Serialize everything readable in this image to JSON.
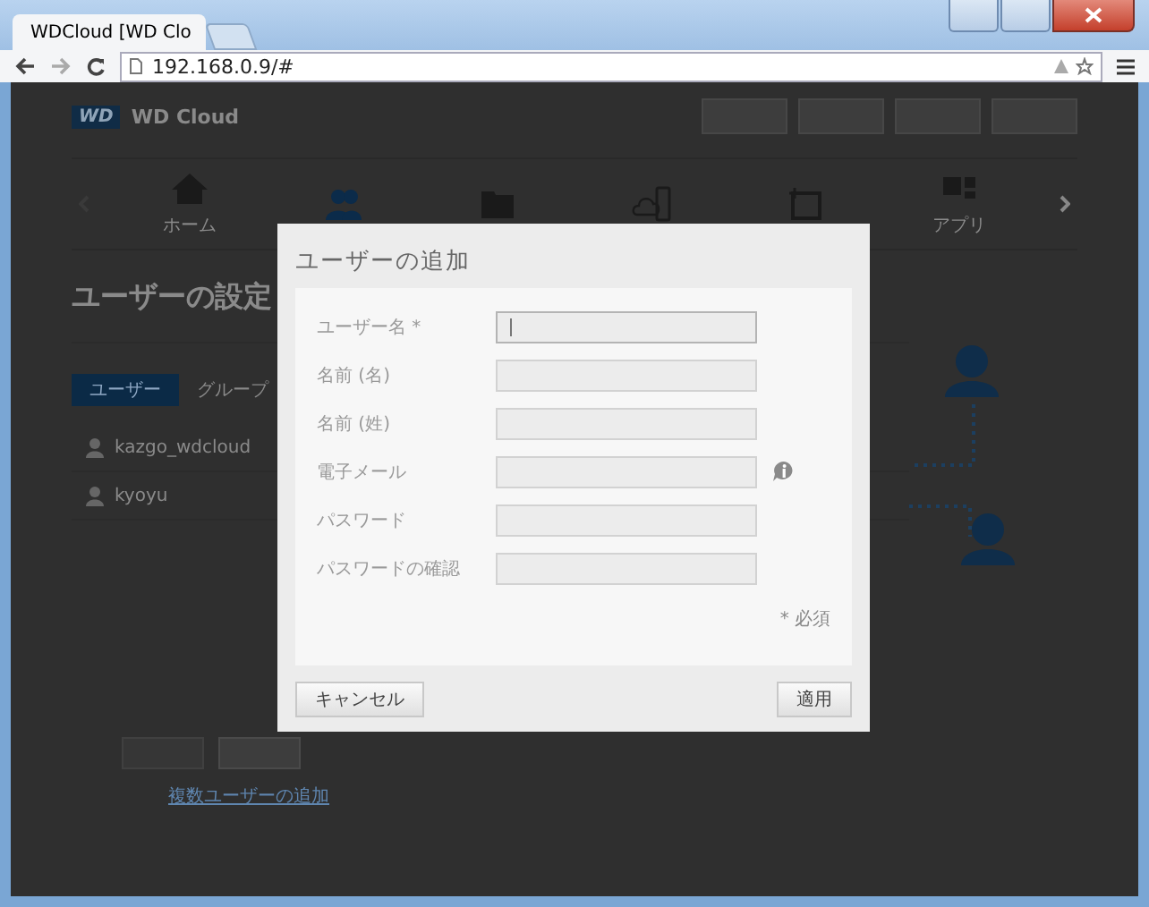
{
  "browser": {
    "tab_title": "WDCloud [WD Clo",
    "url": "192.168.0.9/#"
  },
  "app": {
    "logo": "WD",
    "name": "WD Cloud"
  },
  "nav": [
    {
      "kind": "home",
      "label": "ホーム",
      "selected": false
    },
    {
      "kind": "users",
      "selected": true
    },
    {
      "kind": "folder",
      "selected": false
    },
    {
      "kind": "cloud",
      "selected": false
    },
    {
      "kind": "backup",
      "selected": false
    },
    {
      "kind": "apps",
      "label": "アプリ",
      "selected": false
    }
  ],
  "page_title": "ユーザーの設定",
  "tabs": [
    {
      "label": "ユーザー",
      "selected": true
    },
    {
      "label": "グループ",
      "selected": false
    }
  ],
  "users": [
    {
      "name": "kazgo_wdcloud"
    },
    {
      "name": "kyoyu"
    }
  ],
  "add_multiple_link": "複数ユーザーの追加",
  "dialog": {
    "title": "ユーザーの追加",
    "fields": [
      {
        "label": "ユーザー名 *",
        "focused": true,
        "info": false
      },
      {
        "label": "名前 (名)",
        "focused": false,
        "info": false
      },
      {
        "label": "名前 (姓)",
        "focused": false,
        "info": false
      },
      {
        "label": "電子メール",
        "focused": false,
        "info": true
      },
      {
        "label": "パスワード",
        "focused": false,
        "info": false
      },
      {
        "label": "パスワードの確認",
        "focused": false,
        "info": false
      }
    ],
    "required_note": "* 必須",
    "cancel": "キャンセル",
    "apply": "適用"
  }
}
